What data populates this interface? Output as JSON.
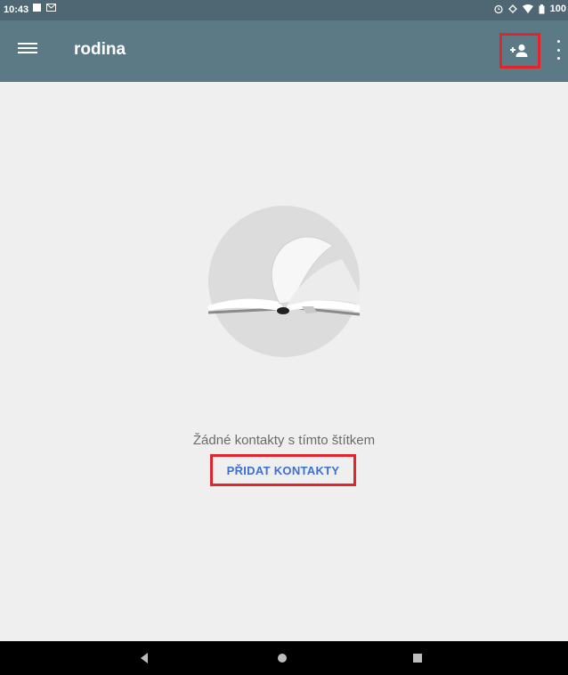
{
  "status_bar": {
    "time": "10:43",
    "battery": "100"
  },
  "app_bar": {
    "title": "rodina"
  },
  "empty_state": {
    "message": "Žádné kontakty s tímto štítkem",
    "action_label": "PŘIDAT KONTAKTY"
  },
  "colors": {
    "status_bar": "#4e6772",
    "app_bar": "#5b7a86",
    "highlight": "#e0252c",
    "accent_text": "#3d6fd0",
    "background": "#efefef"
  },
  "icons": {
    "menu": "hamburger-menu-icon",
    "add_contact": "person-add-icon",
    "overflow": "more-vert-icon",
    "illustration": "open-book-illustration",
    "back": "nav-back-icon",
    "home": "nav-home-icon",
    "recents": "nav-recents-icon"
  }
}
